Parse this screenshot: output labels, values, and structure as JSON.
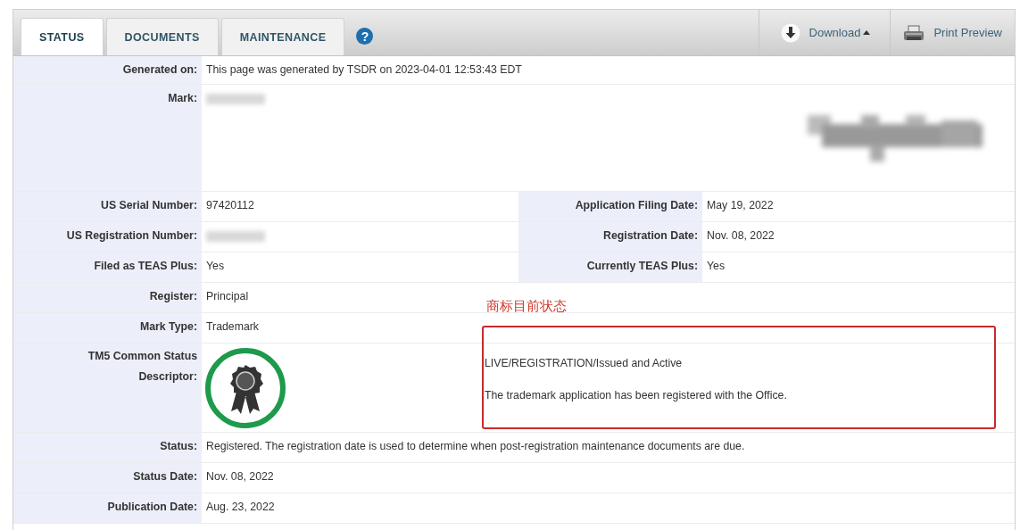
{
  "tabs": [
    {
      "label": "STATUS",
      "selected": true
    },
    {
      "label": "DOCUMENTS",
      "selected": false
    },
    {
      "label": "MAINTENANCE",
      "selected": false
    }
  ],
  "help_button": "?",
  "toolbar": [
    {
      "kind": "download",
      "label": "Download"
    },
    {
      "kind": "print",
      "label": "Print Preview"
    }
  ],
  "rows": [
    {
      "kind": "single",
      "label": "Generated on:",
      "value": "This page was generated by TSDR on 2023-04-01 12:53:43 EDT"
    },
    {
      "kind": "mark",
      "label": "Mark:"
    },
    {
      "kind": "double",
      "cells": [
        {
          "label": "US Serial Number:",
          "value": "97420112",
          "redacted": false
        },
        {
          "label": "Application Filing Date:",
          "value": "May 19, 2022",
          "redacted": false
        }
      ]
    },
    {
      "kind": "double",
      "cells": [
        {
          "label": "US Registration Number:",
          "redacted": true
        },
        {
          "label": "Registration Date:",
          "value": "Nov. 08, 2022",
          "redacted": false
        }
      ]
    },
    {
      "kind": "double",
      "cells": [
        {
          "label": "Filed as TEAS Plus:",
          "value": "Yes",
          "redacted": false
        },
        {
          "label": "Currently TEAS Plus:",
          "value": "Yes",
          "redacted": false
        }
      ]
    },
    {
      "kind": "single",
      "label": "Register:",
      "value": "Principal"
    },
    {
      "kind": "single",
      "label": "Mark Type:",
      "value": "Trademark"
    },
    {
      "kind": "descriptor",
      "label": "TM5 Common Status Descriptor:",
      "lines": [
        "LIVE/REGISTRATION/Issued and Active",
        "The trademark application has been registered with the Office."
      ]
    },
    {
      "kind": "single",
      "label": "Status:",
      "value": "Registered. The registration date is used to determine when post-registration maintenance documents are due."
    },
    {
      "kind": "single",
      "label": "Status Date:",
      "value": "Nov. 08, 2022"
    },
    {
      "kind": "single",
      "label": "Publication Date:",
      "value": "Aug. 23, 2022"
    }
  ],
  "annotation": {
    "label": "商标目前状态"
  }
}
